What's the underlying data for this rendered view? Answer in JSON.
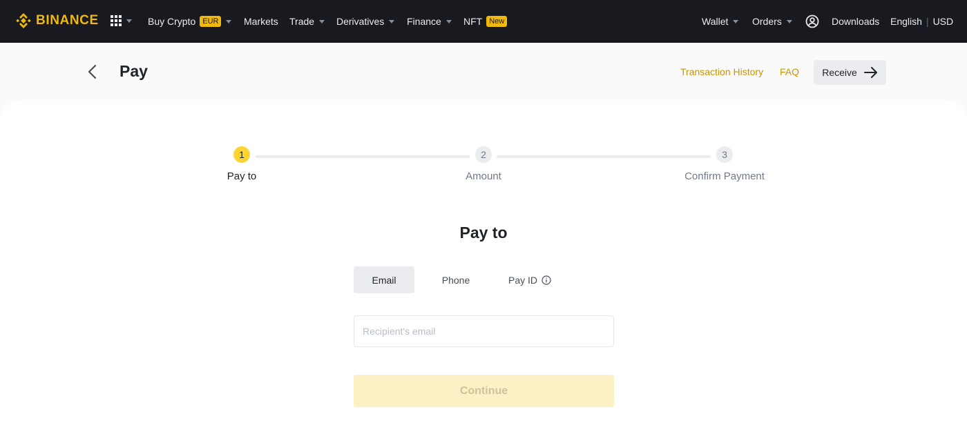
{
  "brand": {
    "name": "BINANCE",
    "color": "#F0B90B"
  },
  "nav": {
    "buy_crypto": "Buy Crypto",
    "buy_crypto_badge": "EUR",
    "markets": "Markets",
    "trade": "Trade",
    "derivatives": "Derivatives",
    "finance": "Finance",
    "nft": "NFT",
    "nft_badge": "New",
    "wallet": "Wallet",
    "orders": "Orders",
    "downloads": "Downloads",
    "language": "English",
    "separator": "|",
    "currency": "USD"
  },
  "header": {
    "title": "Pay",
    "transaction_history": "Transaction History",
    "faq": "FAQ",
    "receive": "Receive"
  },
  "stepper": {
    "steps": [
      {
        "number": "1",
        "label": "Pay to",
        "state": "active"
      },
      {
        "number": "2",
        "label": "Amount",
        "state": "inactive"
      },
      {
        "number": "3",
        "label": "Confirm Payment",
        "state": "inactive"
      }
    ]
  },
  "form": {
    "title": "Pay to",
    "tabs": [
      {
        "label": "Email",
        "selected": true
      },
      {
        "label": "Phone",
        "selected": false
      },
      {
        "label": "Pay ID",
        "selected": false
      }
    ],
    "recipient_placeholder": "Recipient's email",
    "recipient_value": "",
    "continue_label": "Continue"
  },
  "icons": {
    "logo": "binance-diamond-icon",
    "apps": "grid-icon",
    "user": "user-circle-icon",
    "back": "chevron-left-icon",
    "receive_arrow": "arrow-right-icon",
    "info": "info-icon"
  }
}
